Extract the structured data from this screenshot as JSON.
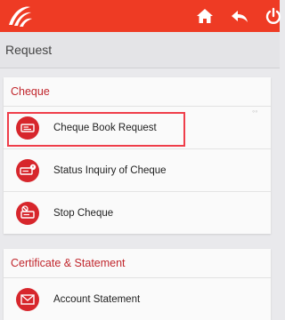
{
  "header": {
    "logo_icon": "bank-of-baroda-logo",
    "icons": [
      "home-icon",
      "back-arrow-icon",
      "power-icon"
    ],
    "accent_color": "#ee3b24"
  },
  "page": {
    "title": "Request"
  },
  "sections": [
    {
      "title": "Cheque",
      "items": [
        {
          "label": "Cheque Book Request",
          "icon": "cheque-book-icon",
          "highlighted": true
        },
        {
          "label": "Status Inquiry of Cheque",
          "icon": "cheque-status-icon"
        },
        {
          "label": "Stop Cheque",
          "icon": "stop-cheque-icon"
        }
      ]
    },
    {
      "title": "Certificate & Statement",
      "items": [
        {
          "label": "Account Statement",
          "icon": "envelope-icon"
        }
      ]
    }
  ]
}
